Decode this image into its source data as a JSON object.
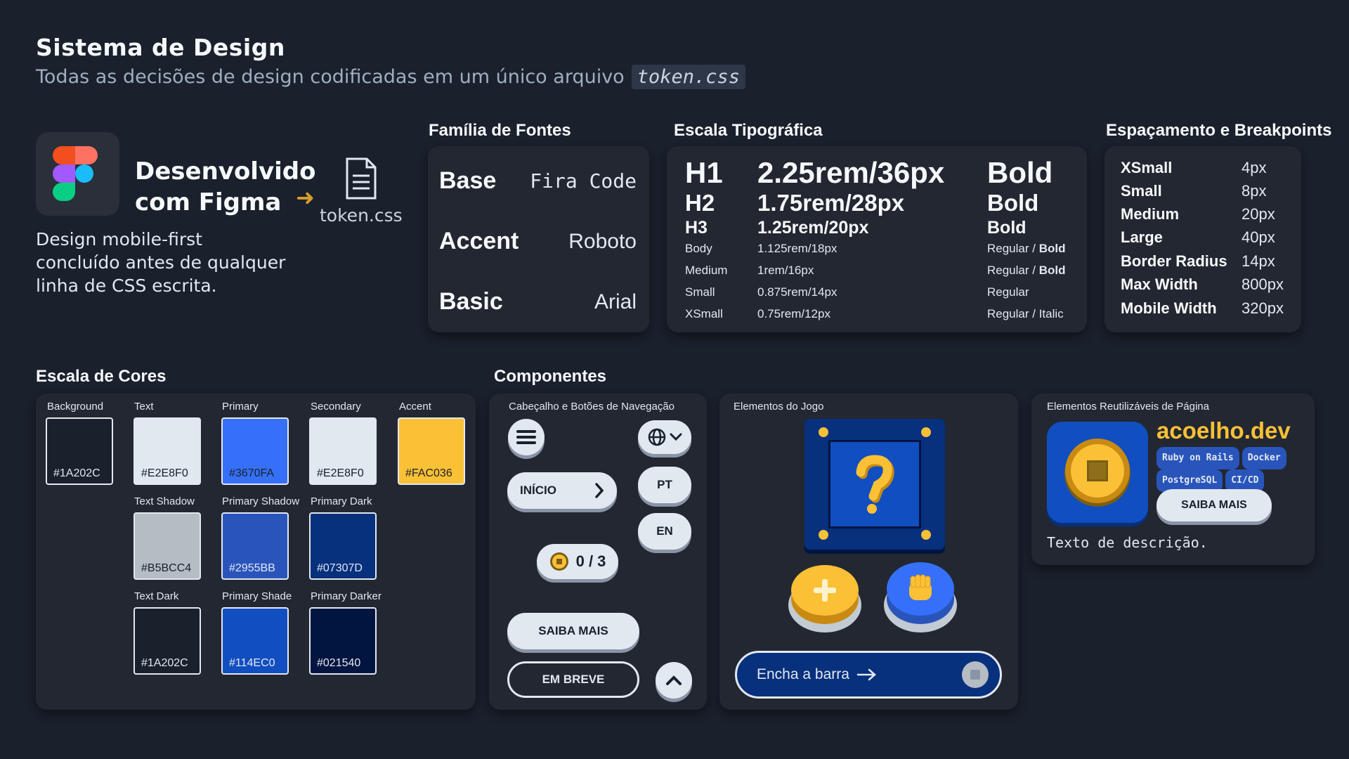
{
  "header": {
    "title": "Sistema de Design",
    "subtitle": "Todas as decisões de design codificadas em um único arquivo",
    "subtitle_code": "token.css"
  },
  "figma": {
    "title_line1": "Desenvolvido",
    "title_line2": "com Figma",
    "file_label": "token.css",
    "desc_line1": "Design mobile-first",
    "desc_line2": "concluído antes de qualquer",
    "desc_line3": "linha de CSS escrita."
  },
  "fonts": {
    "title": "Família de Fontes",
    "rows": [
      {
        "key": "Base",
        "value": "Fira Code"
      },
      {
        "key": "Accent",
        "value": "Roboto"
      },
      {
        "key": "Basic",
        "value": "Arial"
      }
    ]
  },
  "typography": {
    "title": "Escala Tipográfica",
    "rows": [
      {
        "name": "H1",
        "size": "2.25rem/36px",
        "weight": "Bold",
        "weight_bold": ""
      },
      {
        "name": "H2",
        "size": "1.75rem/28px",
        "weight": "Bold",
        "weight_bold": ""
      },
      {
        "name": "H3",
        "size": "1.25rem/20px",
        "weight": "Bold",
        "weight_bold": ""
      },
      {
        "name": "Body",
        "size": "1.125rem/18px",
        "weight": "Regular / ",
        "weight_bold": "Bold"
      },
      {
        "name": "Medium",
        "size": "1rem/16px",
        "weight": "Regular / ",
        "weight_bold": "Bold"
      },
      {
        "name": "Small",
        "size": "0.875rem/14px",
        "weight": "Regular",
        "weight_bold": ""
      },
      {
        "name": "XSmall",
        "size": "0.75rem/12px",
        "weight": "Regular / Italic",
        "weight_bold": ""
      }
    ]
  },
  "spacing": {
    "title": "Espaçamento e Breakpoints",
    "rows": [
      {
        "key": "XSmall",
        "value": "4px"
      },
      {
        "key": "Small",
        "value": "8px"
      },
      {
        "key": "Medium",
        "value": "20px"
      },
      {
        "key": "Large",
        "value": "40px"
      },
      {
        "key": "Border Radius",
        "value": "14px"
      },
      {
        "key": "Max Width",
        "value": "800px"
      },
      {
        "key": "Mobile Width",
        "value": "320px"
      }
    ]
  },
  "colors": {
    "title": "Escala de Cores",
    "swatches": [
      {
        "label": "Background",
        "hex": "#1A202C",
        "text": "#E2E8F0"
      },
      {
        "label": "Text",
        "hex": "#E2E8F0",
        "text": "#1A202C"
      },
      {
        "label": "Primary",
        "hex": "#3670FA",
        "text": "#1A202C"
      },
      {
        "label": "Secondary",
        "hex": "#E2E8F0",
        "text": "#1A202C"
      },
      {
        "label": "Accent",
        "hex": "#FAC036",
        "text": "#1A202C"
      },
      {
        "label": "Text Shadow",
        "hex": "#B5BCC4",
        "text": "#1A202C"
      },
      {
        "label": "Primary Shadow",
        "hex": "#2955BB",
        "text": "#E2E8F0"
      },
      {
        "label": "Primary Dark",
        "hex": "#07307D",
        "text": "#E2E8F0"
      },
      {
        "label": "Text Dark",
        "hex": "#1A202C",
        "text": "#E2E8F0"
      },
      {
        "label": "Primary Shade",
        "hex": "#114EC0",
        "text": "#E2E8F0"
      },
      {
        "label": "Primary Darker",
        "hex": "#021540",
        "text": "#E2E8F0"
      }
    ]
  },
  "components": {
    "title": "Componentes",
    "nav": {
      "label": "Cabeçalho e Botões de Navegação",
      "inicio": "INÍCIO",
      "pt": "PT",
      "en": "EN",
      "counter": "0 / 3",
      "saiba_mais": "SAIBA MAIS",
      "em_breve": "EM BREVE"
    },
    "game": {
      "label": "Elementos do Jogo",
      "bar_label": "Encha a barra"
    },
    "reuse": {
      "label": "Elementos Reutilizáveis de Página",
      "brand": "acoelho.dev",
      "tags": [
        "Ruby on Rails",
        "Docker",
        "PostgreSQL",
        "CI/CD"
      ],
      "button": "SAIBA MAIS",
      "description": "Texto de descrição."
    }
  }
}
